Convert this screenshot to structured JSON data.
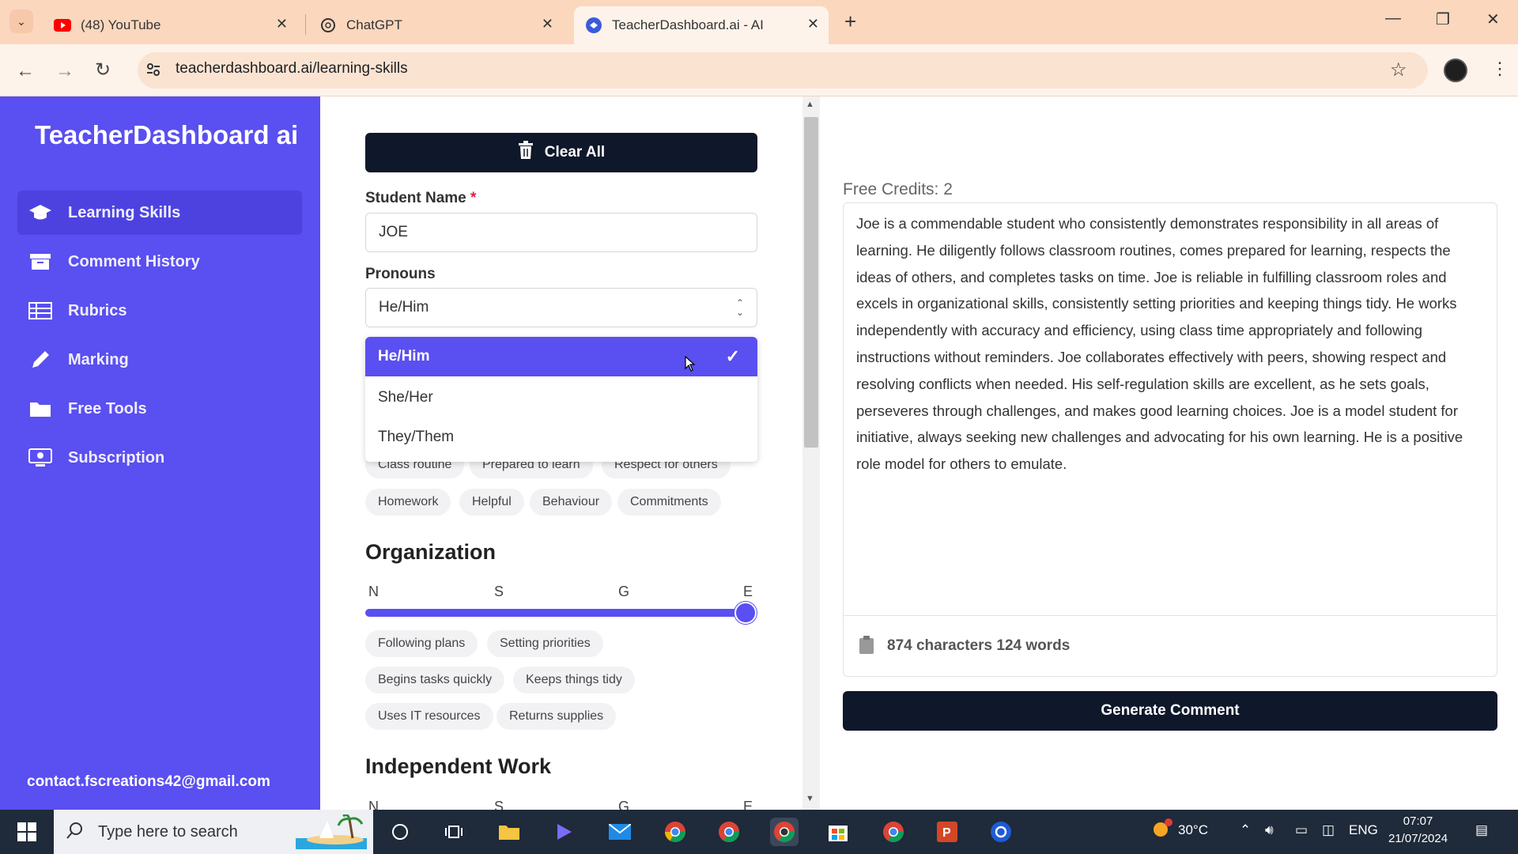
{
  "browser": {
    "tabs": [
      {
        "title": "(48) YouTube",
        "icon": "youtube-icon"
      },
      {
        "title": "ChatGPT",
        "icon": "chatgpt-icon"
      },
      {
        "title": "TeacherDashboard.ai - AI",
        "icon": "teacherdashboard-icon",
        "active": true
      }
    ],
    "url": "teacherdashboard.ai/learning-skills"
  },
  "sidebar": {
    "brand": "TeacherDashboard ai",
    "items": [
      {
        "label": "Learning Skills",
        "icon": "graduation-cap-icon",
        "active": true
      },
      {
        "label": "Comment History",
        "icon": "archive-icon"
      },
      {
        "label": "Rubrics",
        "icon": "table-icon"
      },
      {
        "label": "Marking",
        "icon": "pencil-icon"
      },
      {
        "label": "Free Tools",
        "icon": "folder-icon"
      },
      {
        "label": "Subscription",
        "icon": "monitor-icon"
      }
    ],
    "email": "contact.fscreations42@gmail.com"
  },
  "form": {
    "clear_label": "Clear All",
    "student_name_label": "Student Name",
    "required_mark": "*",
    "student_name_value": "JOE",
    "pronouns_label": "Pronouns",
    "pronouns_value": "He/Him",
    "pronoun_options": [
      "He/Him",
      "She/Her",
      "They/Them"
    ],
    "responsibility_chips": [
      "Class routine",
      "Prepared to learn",
      "Respect for others",
      "Homework",
      "Helpful",
      "Behaviour",
      "Commitments"
    ],
    "organization_title": "Organization",
    "scale_labels": [
      "N",
      "S",
      "G",
      "E"
    ],
    "organization_level": "E",
    "organization_chips": [
      "Following plans",
      "Setting priorities",
      "Begins tasks quickly",
      "Keeps things tidy",
      "Uses IT resources",
      "Returns supplies"
    ],
    "independent_title": "Independent Work"
  },
  "output": {
    "credits": "Free Credits: 2",
    "comment": "Joe is a commendable student who consistently demonstrates responsibility in all areas of learning. He diligently follows classroom routines, comes prepared for learning, respects the ideas of others, and completes tasks on time. Joe is reliable in fulfilling classroom roles and excels in organizational skills, consistently setting priorities and keeping things tidy. He works independently with accuracy and efficiency, using class time appropriately and following instructions without reminders. Joe collaborates effectively with peers, showing respect and resolving conflicts when needed. His self-regulation skills are excellent, as he sets goals, perseveres through challenges, and makes good learning choices. Joe is a model student for initiative, always seeking new challenges and advocating for his own learning. He is a positive role model for others to emulate.",
    "counts": "874 characters  124 words",
    "generate_label": "Generate Comment"
  },
  "taskbar": {
    "search_placeholder": "Type here to search",
    "temperature": "30°C",
    "language": "ENG",
    "time": "07:07",
    "date": "21/07/2024"
  },
  "colors": {
    "sidebar": "#5a4ff0",
    "dark_button": "#0f172a",
    "tab_bar": "#fbd7be"
  }
}
